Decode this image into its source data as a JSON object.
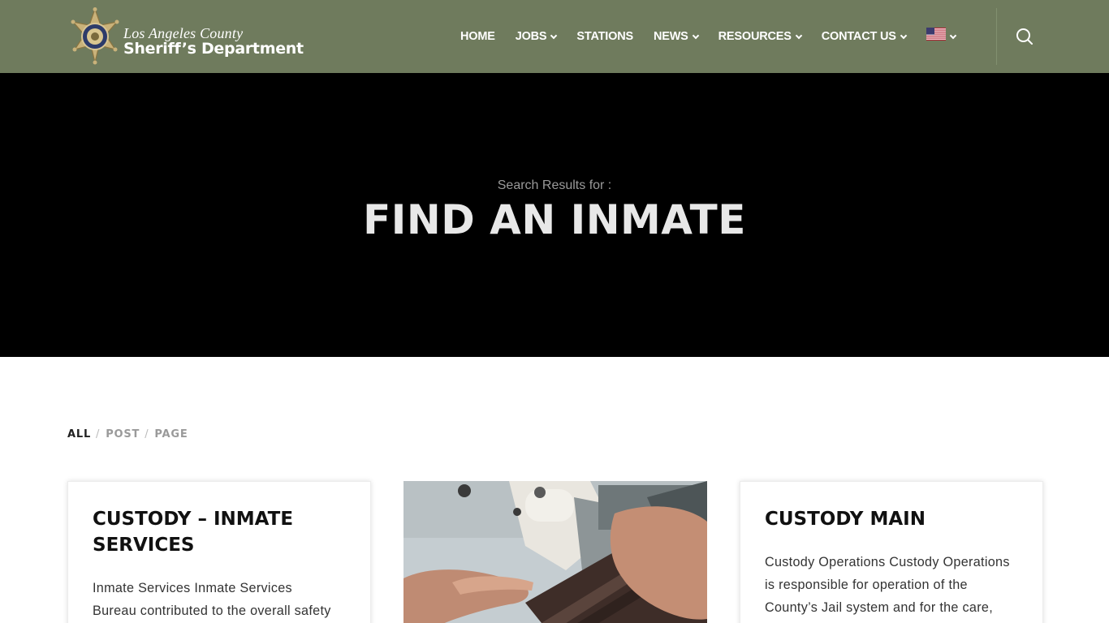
{
  "header": {
    "logo": {
      "county": "Los Angeles County",
      "department": "Sheriff’s Department"
    },
    "nav": [
      {
        "label": "HOME",
        "has_dropdown": false
      },
      {
        "label": "JOBS",
        "has_dropdown": true
      },
      {
        "label": "STATIONS",
        "has_dropdown": false
      },
      {
        "label": "NEWS",
        "has_dropdown": true
      },
      {
        "label": "RESOURCES",
        "has_dropdown": true
      },
      {
        "label": "CONTACT US",
        "has_dropdown": true
      }
    ],
    "language_icon": "us-flag-icon",
    "search_icon": "search-icon",
    "background_color": "#6f7b5d"
  },
  "hero": {
    "subtitle": "Search Results for :",
    "title": "FIND AN INMATE"
  },
  "filters": [
    {
      "label": "ALL",
      "active": true
    },
    {
      "label": "POST",
      "active": false
    },
    {
      "label": "PAGE",
      "active": false
    }
  ],
  "results": [
    {
      "title": "CUSTODY – INMATE SERVICES",
      "excerpt_lines": [
        "Inmate Services Inmate Services",
        "Bureau contributed to the overall safety"
      ]
    },
    {
      "image": "sewing-machine-photo"
    },
    {
      "title": "CUSTODY MAIN",
      "excerpt_lines": [
        "Custody Operations Custody Operations",
        "is responsible for operation of the",
        "County’s Jail system and for the care,"
      ]
    }
  ]
}
